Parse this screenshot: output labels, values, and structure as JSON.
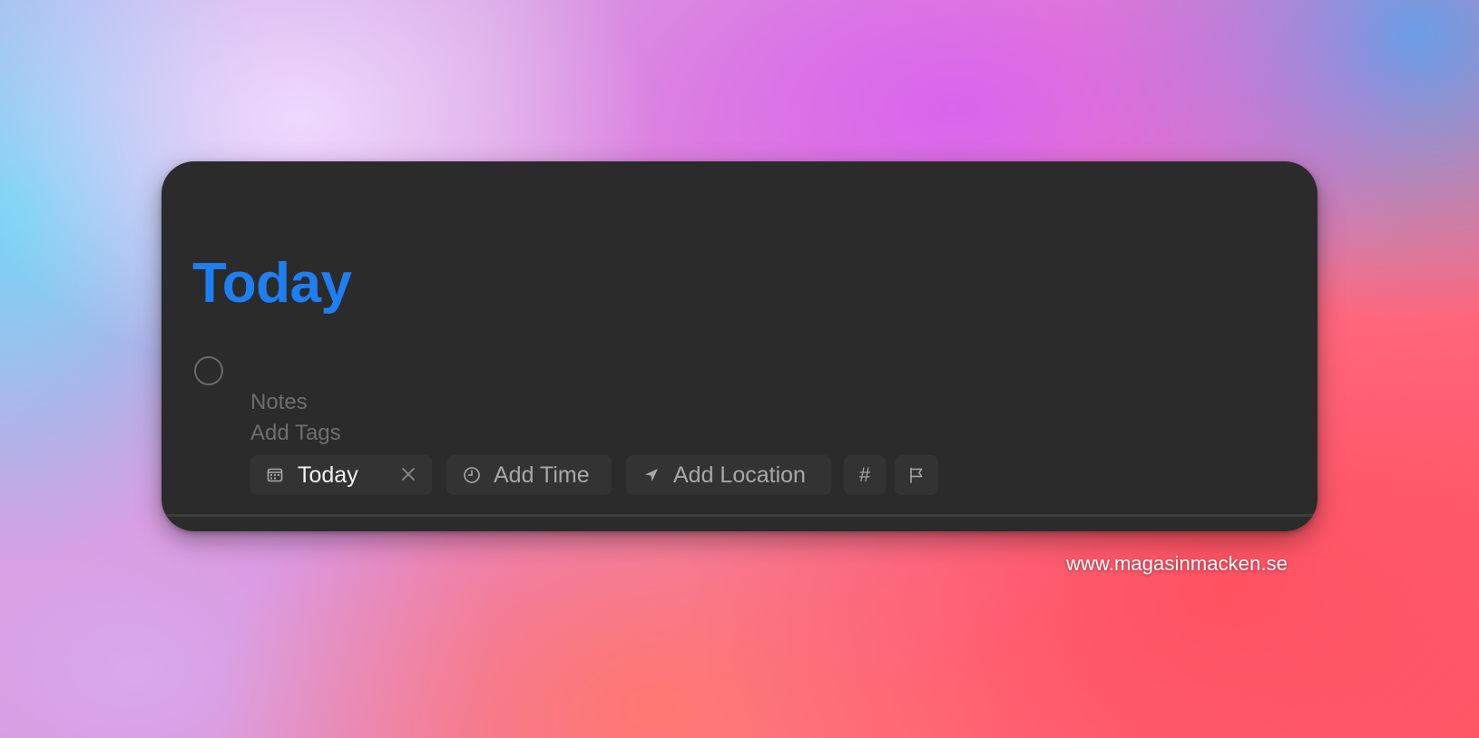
{
  "page": {
    "title": "Today",
    "notes_placeholder": "Notes",
    "tags_placeholder": "Add Tags"
  },
  "toolbar": {
    "date_chip": {
      "label": "Today",
      "icon": "calendar-icon",
      "clear_icon": "close-icon"
    },
    "time_chip": {
      "label": "Add Time",
      "icon": "clock-icon"
    },
    "location_chip": {
      "label": "Add Location",
      "icon": "location-arrow-icon"
    },
    "tag_chip": {
      "label": "#"
    },
    "flag_chip": {
      "icon": "flag-icon"
    }
  },
  "watermark": "www.magasinmacken.se",
  "colors": {
    "accent": "#1d7ff2",
    "panel": "#2b2b2b",
    "chip": "#333333",
    "muted_text": "#6e6e6e"
  }
}
